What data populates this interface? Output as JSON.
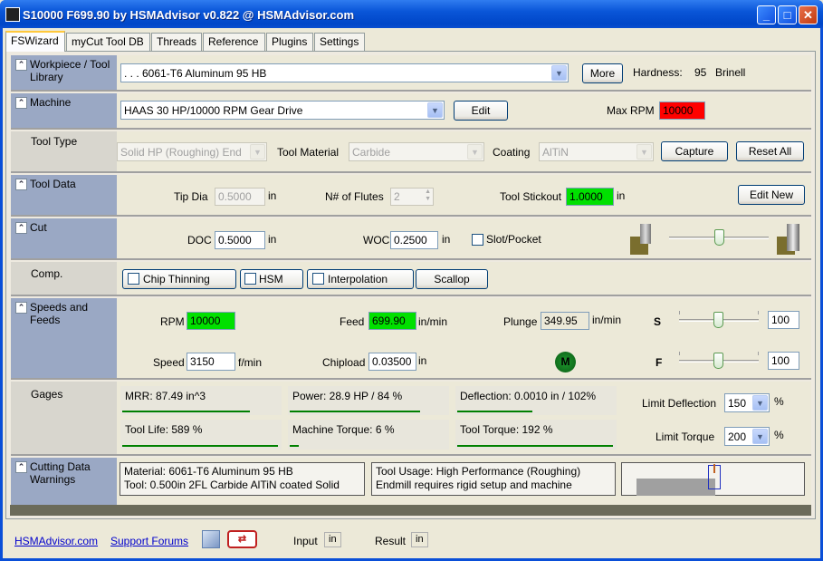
{
  "window": {
    "title": "S10000 F699.90 by HSMAdvisor v0.822 @ HSMAdvisor.com",
    "minimize": "_",
    "maximize": "□",
    "close": "✕"
  },
  "tabs": [
    "FSWizard",
    "myCut Tool DB",
    "Threads",
    "Reference",
    "Plugins",
    "Settings"
  ],
  "workpiece": {
    "label": "Workpiece / Tool Library",
    "material": ". . . 6061-T6 Aluminum 95 HB",
    "more": "More",
    "hardness_label": "Hardness:",
    "hardness_value": "95",
    "hardness_unit": "Brinell"
  },
  "machine": {
    "label": "Machine",
    "value": "HAAS 30 HP/10000 RPM Gear Drive",
    "edit": "Edit",
    "maxrpm_label": "Max RPM",
    "maxrpm": "10000"
  },
  "tooltype": {
    "label": "Tool Type",
    "type": "Solid HP (Roughing) End",
    "material_label": "Tool Material",
    "material": "Carbide",
    "coating_label": "Coating",
    "coating": "AlTiN",
    "capture": "Capture",
    "reset": "Reset All"
  },
  "tooldata": {
    "label": "Tool Data",
    "tipdia_label": "Tip Dia",
    "tipdia": "0.5000",
    "tipdia_unit": "in",
    "flutes_label": "N# of Flutes",
    "flutes": "2",
    "stickout_label": "Tool Stickout",
    "stickout": "1.0000",
    "stickout_unit": "in",
    "editnew": "Edit New"
  },
  "cut": {
    "label": "Cut",
    "doc_label": "DOC",
    "doc": "0.5000",
    "doc_unit": "in",
    "woc_label": "WOC",
    "woc": "0.2500",
    "woc_unit": "in",
    "slot_label": "Slot/Pocket"
  },
  "comp": {
    "label": "Comp.",
    "chip": "Chip Thinning",
    "hsm": "HSM",
    "interp": "Interpolation",
    "scallop": "Scallop"
  },
  "speeds": {
    "label": "Speeds and Feeds",
    "rpm_label": "RPM",
    "rpm": "10000",
    "feed_label": "Feed",
    "feed": "699.90",
    "feed_unit": "in/min",
    "plunge_label": "Plunge",
    "plunge": "349.95",
    "plunge_unit": "in/min",
    "s_label": "S",
    "s_value": "100",
    "speed_label": "Speed",
    "speed": "3150",
    "speed_unit": "f/min",
    "chipload_label": "Chipload",
    "chipload": "0.03500",
    "chipload_unit": "in",
    "m_label": "M",
    "f_label": "F",
    "f_value": "100"
  },
  "gages": {
    "label": "Gages",
    "items": [
      {
        "text": "MRR: 87.49 in^3",
        "fill": 0.82
      },
      {
        "text": "Power: 28.9 HP / 84 %",
        "fill": 0.84
      },
      {
        "text": "Deflection: 0.0010 in / 102%",
        "fill": 0.48
      },
      {
        "text": "Tool Life: 589 %",
        "fill": 1.0
      },
      {
        "text": "Machine Torque: 6 %",
        "fill": 0.06
      },
      {
        "text": "Tool Torque: 192 %",
        "fill": 1.0
      }
    ],
    "limit_defl_label": "Limit Deflection",
    "limit_defl": "150",
    "limit_torque_label": "Limit Torque",
    "limit_torque": "200",
    "pct": "%"
  },
  "warnings": {
    "label": "Cutting Data Warnings",
    "line1": "Material: 6061-T6 Aluminum 95 HB",
    "line2": "Tool: 0.500in 2FL Carbide AlTiN coated Solid",
    "line3": "Tool Usage: High Performance (Roughing)",
    "line4": "Endmill requires rigid setup and machine"
  },
  "status": {
    "site": "HSMAdvisor.com",
    "forums": "Support Forums",
    "input_label": "Input",
    "input_unit": "in",
    "result_label": "Result",
    "result_unit": "in"
  },
  "colors": {
    "green": "#00e000",
    "red": "#ff0000",
    "label_bg": "#9aa8c4"
  }
}
